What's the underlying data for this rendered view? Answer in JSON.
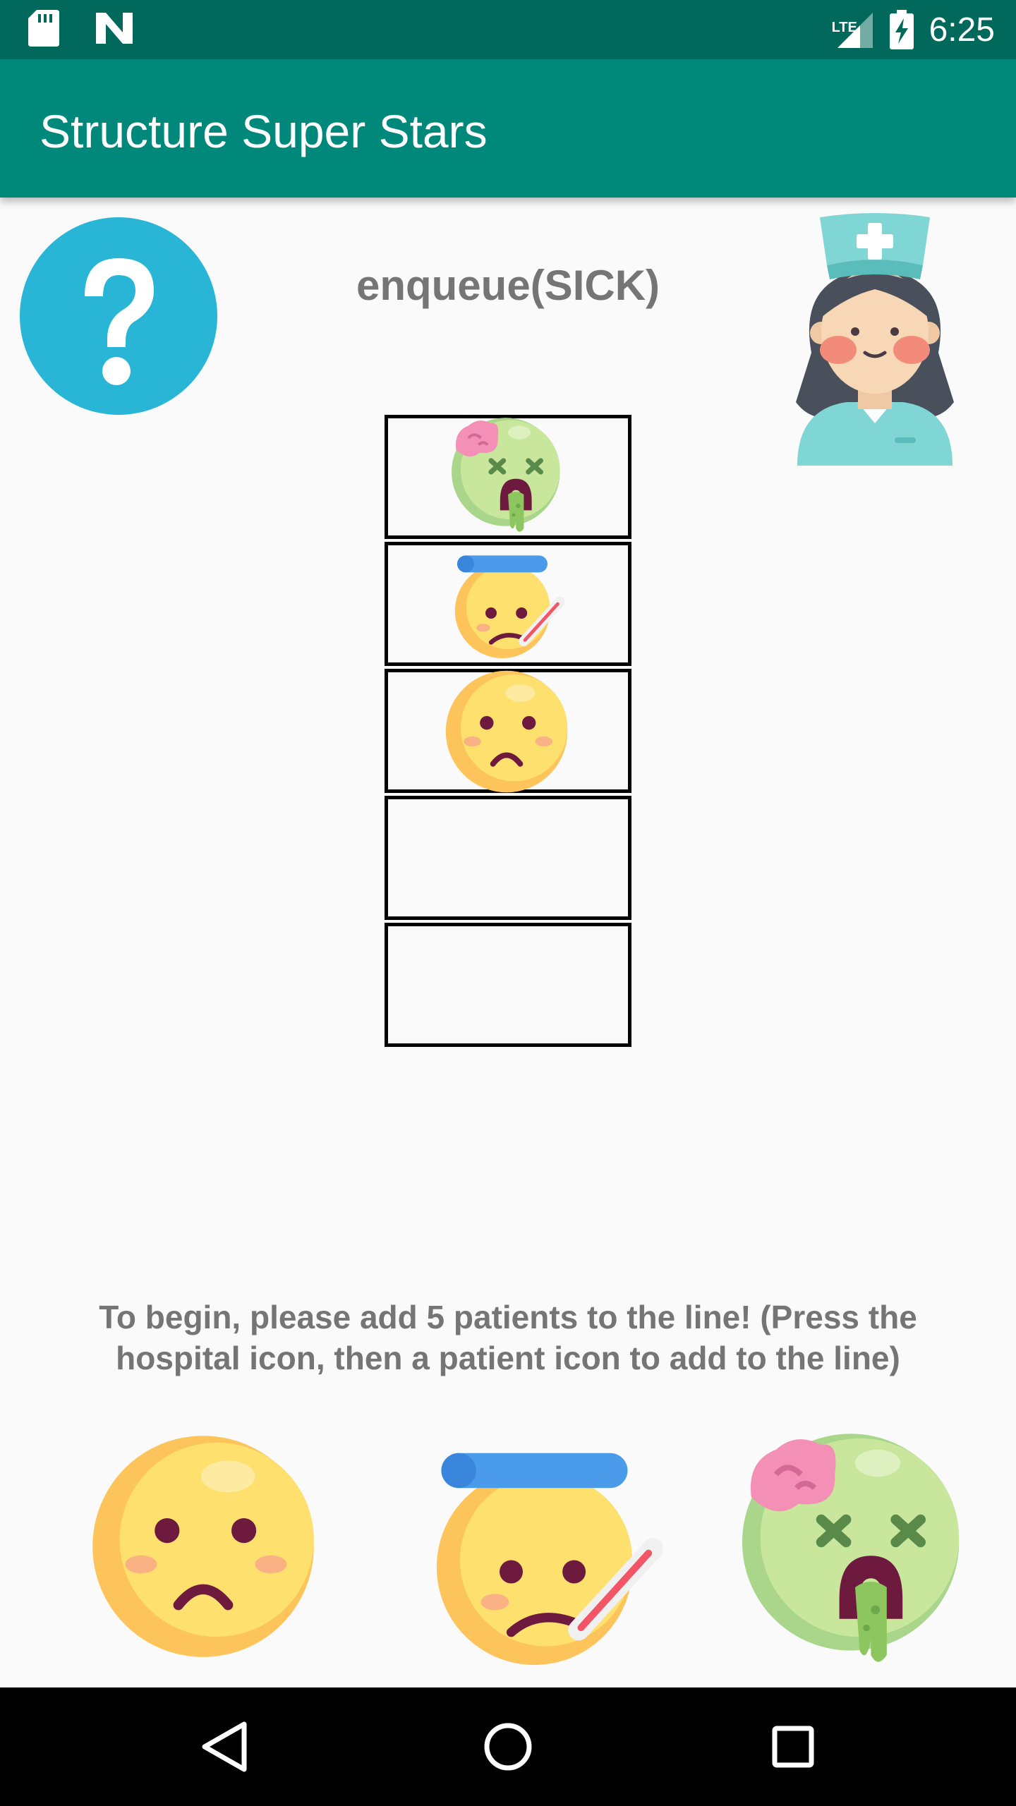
{
  "status_bar": {
    "time": "6:25",
    "network_label": "LTE",
    "icons": [
      "sd-card-icon",
      "n-notification-icon",
      "signal-icon",
      "battery-charging-icon"
    ]
  },
  "app_bar": {
    "title": "Structure Super Stars"
  },
  "help": {
    "icon": "question-mark-icon",
    "color": "#29b6d6"
  },
  "nurse": {
    "icon": "nurse-icon"
  },
  "operation_label": "enqueue(SICK)",
  "queue": {
    "capacity": 5,
    "slots": [
      "zombie",
      "fever",
      "sick",
      "",
      ""
    ]
  },
  "instructions": "To begin, please add 5 patients to the line! (Press the hospital icon, then a patient icon to add to the line)",
  "patient_buttons": [
    {
      "type": "sick",
      "icon": "sick-face-icon"
    },
    {
      "type": "fever",
      "icon": "fever-face-icon"
    },
    {
      "type": "zombie",
      "icon": "zombie-face-icon"
    }
  ],
  "nav_bar": {
    "buttons": [
      "back-icon",
      "home-icon",
      "recents-icon"
    ]
  },
  "colors": {
    "status_bar": "#00695c",
    "app_bar": "#00897b",
    "face_yellow": "#fdd96e",
    "zombie_green": "#c5e59a"
  }
}
